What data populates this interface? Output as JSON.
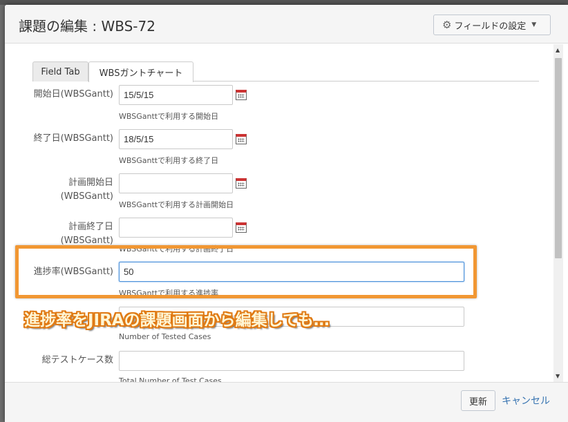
{
  "dialog": {
    "title": "課題の編集 : WBS-72",
    "field_config_label": "フィールドの設定"
  },
  "tabs": [
    {
      "label": "Field Tab",
      "active": false
    },
    {
      "label": "WBSガントチャート",
      "active": true
    }
  ],
  "fields": {
    "start_date": {
      "label": "開始日(WBSGantt)",
      "value": "15/5/15",
      "help": "WBSGanttで利用する開始日"
    },
    "end_date": {
      "label": "終了日(WBSGantt)",
      "value": "18/5/15",
      "help": "WBSGanttで利用する終了日"
    },
    "planned_start": {
      "label_line1": "計画開始日",
      "label_line2": "(WBSGantt)",
      "value": "",
      "help": "WBSGanttで利用する計画開始日"
    },
    "planned_end": {
      "label_line1": "計画終了日",
      "label_line2": "(WBSGantt)",
      "value": "",
      "help": "WBSGanttで利用する計画終了日"
    },
    "progress": {
      "label": "進捗率(WBSGantt)",
      "value": "50",
      "help": "WBSGanttで利用する進捗率"
    },
    "tested_cases": {
      "value": "",
      "help": "Number of Tested Cases"
    },
    "total_cases": {
      "label": "総テストケース数",
      "value": "",
      "help": "Total Number of Test Cases"
    }
  },
  "annotation": "進捗率をJIRAの課題画面から編集しても…",
  "footer": {
    "update_label": "更新",
    "cancel_label": "キャンセル"
  },
  "colors": {
    "highlight": "#f19733",
    "link": "#3572b0",
    "annotation_text": "#fff6d5"
  },
  "icons": [
    "gear-icon",
    "calendar-icon",
    "chevron-down-icon"
  ]
}
